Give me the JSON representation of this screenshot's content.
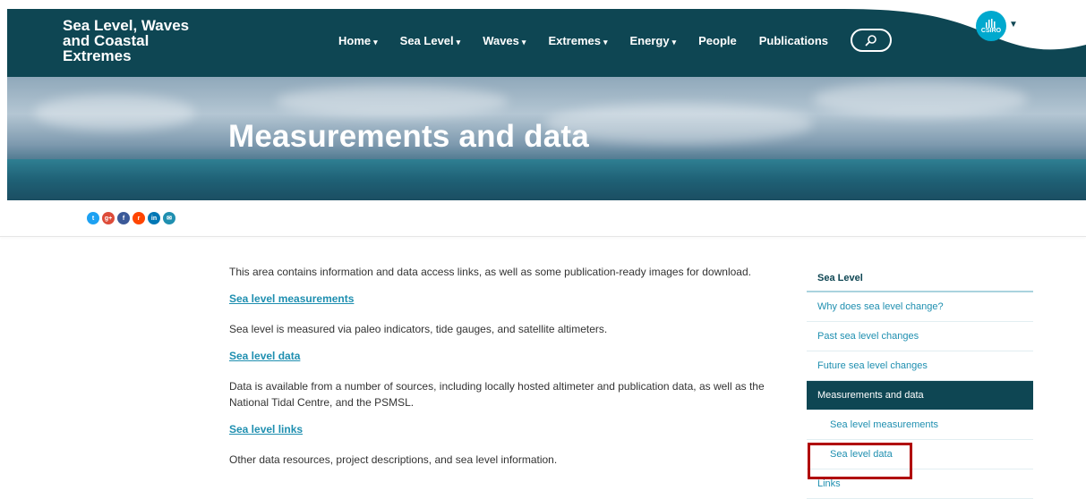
{
  "header": {
    "site_title_line1": "Sea Level, Waves",
    "site_title_line2": "and Coastal",
    "site_title_line3": "Extremes",
    "nav": [
      {
        "label": "Home",
        "dropdown": true
      },
      {
        "label": "Sea Level",
        "dropdown": true
      },
      {
        "label": "Waves",
        "dropdown": true
      },
      {
        "label": "Extremes",
        "dropdown": true
      },
      {
        "label": "Energy",
        "dropdown": true
      },
      {
        "label": "People",
        "dropdown": false
      },
      {
        "label": "Publications",
        "dropdown": false
      }
    ],
    "caret": "▾",
    "search_icon": "search-icon",
    "logo_text": "CSIRO",
    "logo_caret": "▼"
  },
  "hero": {
    "title": "Measurements and data"
  },
  "social": [
    {
      "icon": "twitter-icon",
      "glyph": "t",
      "color": "#1da1f2"
    },
    {
      "icon": "google-plus-icon",
      "glyph": "g+",
      "color": "#dd4b39"
    },
    {
      "icon": "facebook-icon",
      "glyph": "f",
      "color": "#3b5998"
    },
    {
      "icon": "reddit-icon",
      "glyph": "r",
      "color": "#ff4500"
    },
    {
      "icon": "linkedin-icon",
      "glyph": "in",
      "color": "#0077b5"
    },
    {
      "icon": "email-icon",
      "glyph": "✉",
      "color": "#1f8fb0"
    }
  ],
  "main": {
    "intro": "This area contains information and data access links, as well as some publication-ready images for download.",
    "sections": [
      {
        "link": "Sea level measurements",
        "text": "Sea level is measured via paleo indicators, tide gauges, and satellite altimeters."
      },
      {
        "link": "Sea level data",
        "text": "Data is available from a number of sources, including locally hosted altimeter and publication data, as well as the National Tidal Centre, and the PSMSL."
      },
      {
        "link": "Sea level links",
        "text": "Other data resources, project descriptions, and sea level information."
      }
    ]
  },
  "sidebar": {
    "heading": "Sea Level",
    "items": [
      {
        "label": "Why does sea level change?"
      },
      {
        "label": "Past sea level changes"
      },
      {
        "label": "Future sea level changes"
      },
      {
        "label": "Measurements and data"
      },
      {
        "label": "Sea level measurements"
      },
      {
        "label": "Sea level data"
      },
      {
        "label": "Links"
      }
    ]
  },
  "colors": {
    "header_bg": "#0e4653",
    "link": "#1f8fb0",
    "active_bg": "#0e4653",
    "highlight": "#b00000"
  }
}
